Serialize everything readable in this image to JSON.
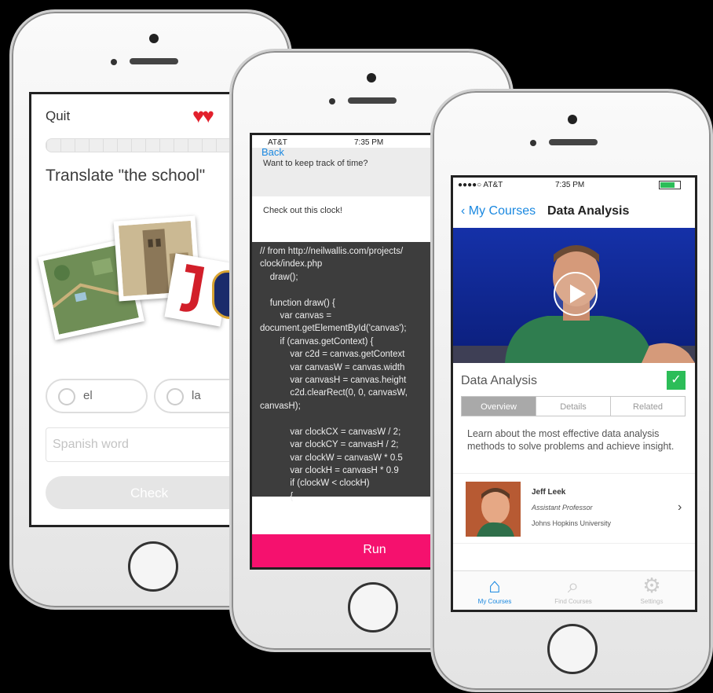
{
  "phone1": {
    "quit_label": "Quit",
    "hearts": "♥♥",
    "prompt": "Translate \"the school\"",
    "answers": [
      "el",
      "la"
    ],
    "word_placeholder": "Spanish word",
    "check_label": "Check"
  },
  "phone2": {
    "carrier": "AT&T",
    "time": "7:35 PM",
    "back_label": "Back",
    "question1": "Want to keep track of time?",
    "question2": "Check out this clock!",
    "code": "// from http://neilwallis.com/projects/\nclock/index.php\n    draw();\n\n    function draw() {\n        var canvas =\ndocument.getElementById('canvas');\n        if (canvas.getContext) {\n            var c2d = canvas.getContext\n            var canvasW = canvas.width\n            var canvasH = canvas.height\n            c2d.clearRect(0, 0, canvasW,\ncanvasH);\n\n            var clockCX = canvasW / 2;\n            var clockCY = canvasH / 2;\n            var clockW = canvasW * 0.5\n            var clockH = canvasH * 0.9\n            if (clockW < clockH)\n            {",
    "run_label": "Run"
  },
  "phone3": {
    "carrier": "●●●●○ AT&T",
    "time": "7:35 PM",
    "nav_back": "My Courses",
    "nav_title": "Data Analysis",
    "course_title": "Data Analysis",
    "tabs": [
      "Overview",
      "Details",
      "Related"
    ],
    "description": "Learn about the most effective data analysis methods to solve problems and achieve insight.",
    "instructor": {
      "name": "Jeff Leek",
      "role": "Assistant Professor",
      "university": "Johns Hopkins University"
    },
    "tabbar": [
      {
        "label": "My Courses",
        "icon": "home-icon"
      },
      {
        "label": "Find Courses",
        "icon": "search-icon"
      },
      {
        "label": "Settings",
        "icon": "gear-icon"
      }
    ],
    "accent": "#1a88e0",
    "check_color": "#2cbd58"
  },
  "colors": {
    "run_button": "#f5116e",
    "hearts": "#e2202c"
  }
}
